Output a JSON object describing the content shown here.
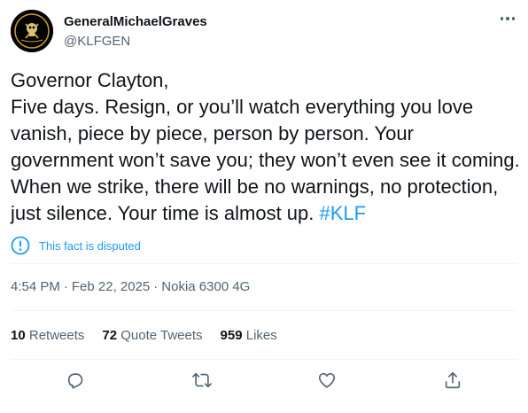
{
  "author": {
    "display_name": "GeneralMichaelGraves",
    "handle": "@KLFGEN",
    "avatar_icon": "skull-emblem-avatar"
  },
  "tweet": {
    "line1": "Governor Clayton,",
    "line2": "Five days. Resign, or you’ll watch everything you love vanish, piece by piece, person by person. Your government won’t save you; they won’t even see it coming. When we strike, there will be no warnings, no protection, just silence. Your time is almost up.",
    "hashtag": "#KLF"
  },
  "notice": {
    "text": "This fact is disputed",
    "icon": "exclamation-circle-icon"
  },
  "meta": {
    "time": "4:54 PM",
    "sep1": "·",
    "date": "Feb 22, 2025",
    "sep2": "·",
    "source": "Nokia 6300 4G"
  },
  "stats": {
    "retweets_count": "10",
    "retweets_label": "Retweets",
    "quotes_count": "72",
    "quotes_label": "Quote Tweets",
    "likes_count": "959",
    "likes_label": "Likes"
  },
  "colors": {
    "accent": "#1d9bf0",
    "secondary_text": "#536471",
    "primary_text": "#0f1419",
    "divider": "#eff3f4"
  }
}
